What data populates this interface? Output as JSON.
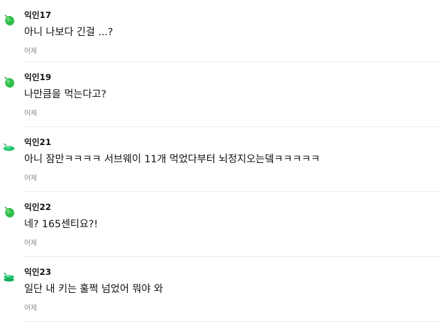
{
  "comments": [
    {
      "author": "익인17",
      "text": "아니 나보다 긴걸 ...?",
      "date": "어제",
      "avatar_color": "#2fbf4a",
      "avatar_icon": "leaf-avatar-icon"
    },
    {
      "author": "익인19",
      "text": "나만큼을 먹는다고?",
      "date": "어제",
      "avatar_color": "#2fbf4a",
      "avatar_icon": "leaf-avatar-icon"
    },
    {
      "author": "익인21",
      "text": "아니 잠만ㅋㅋㅋㅋ 서브웨이 11개 먹었다부터 뇌정지오는뎈ㅋㅋㅋㅋㅋ",
      "date": "어제",
      "avatar_color": "#19c46c",
      "avatar_icon": "sprout-avatar-icon"
    },
    {
      "author": "익인22",
      "text": "네? 165센티요?!",
      "date": "어제",
      "avatar_color": "#2fbf4a",
      "avatar_icon": "leaf-avatar-icon"
    },
    {
      "author": "익인23",
      "text": "일단 내 키는 훌쩍 넘었어 뭐야 와",
      "date": "어제",
      "avatar_color": "#19c46c",
      "avatar_icon": "stack-avatar-icon"
    }
  ]
}
